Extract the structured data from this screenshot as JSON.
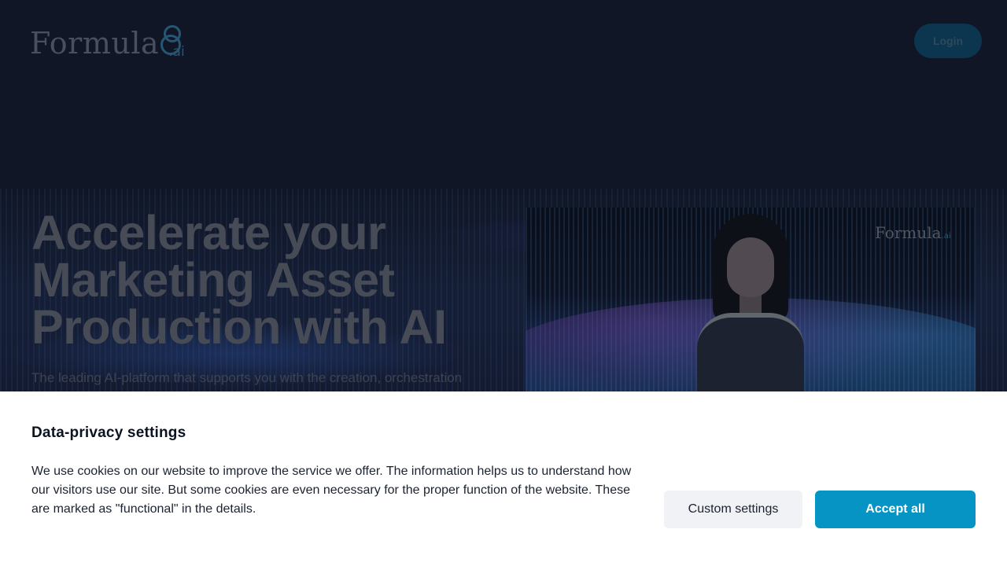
{
  "header": {
    "logo_word": "Formula",
    "logo_suffix": ".ai",
    "login_label": "Login"
  },
  "hero": {
    "title": "Accelerate your Marketing Asset Production with AI",
    "subtitle": "The leading AI-platform that supports you with the creation, orchestration"
  },
  "video": {
    "logo_word": "Formula",
    "logo_suffix": ".ai"
  },
  "cookie_banner": {
    "title": "Data-privacy settings",
    "text": "We use cookies on our website to improve the service we offer. The information helps us to understand how our visitors use our site. But some cookies are even necessary for the proper function of the website. These are marked as \"functional\" in the details.",
    "custom_settings_label": "Custom settings",
    "accept_all_label": "Accept all"
  },
  "colors": {
    "accent": "#0594c4",
    "page_background": "#131a2a",
    "banner_background": "#ffffff"
  }
}
